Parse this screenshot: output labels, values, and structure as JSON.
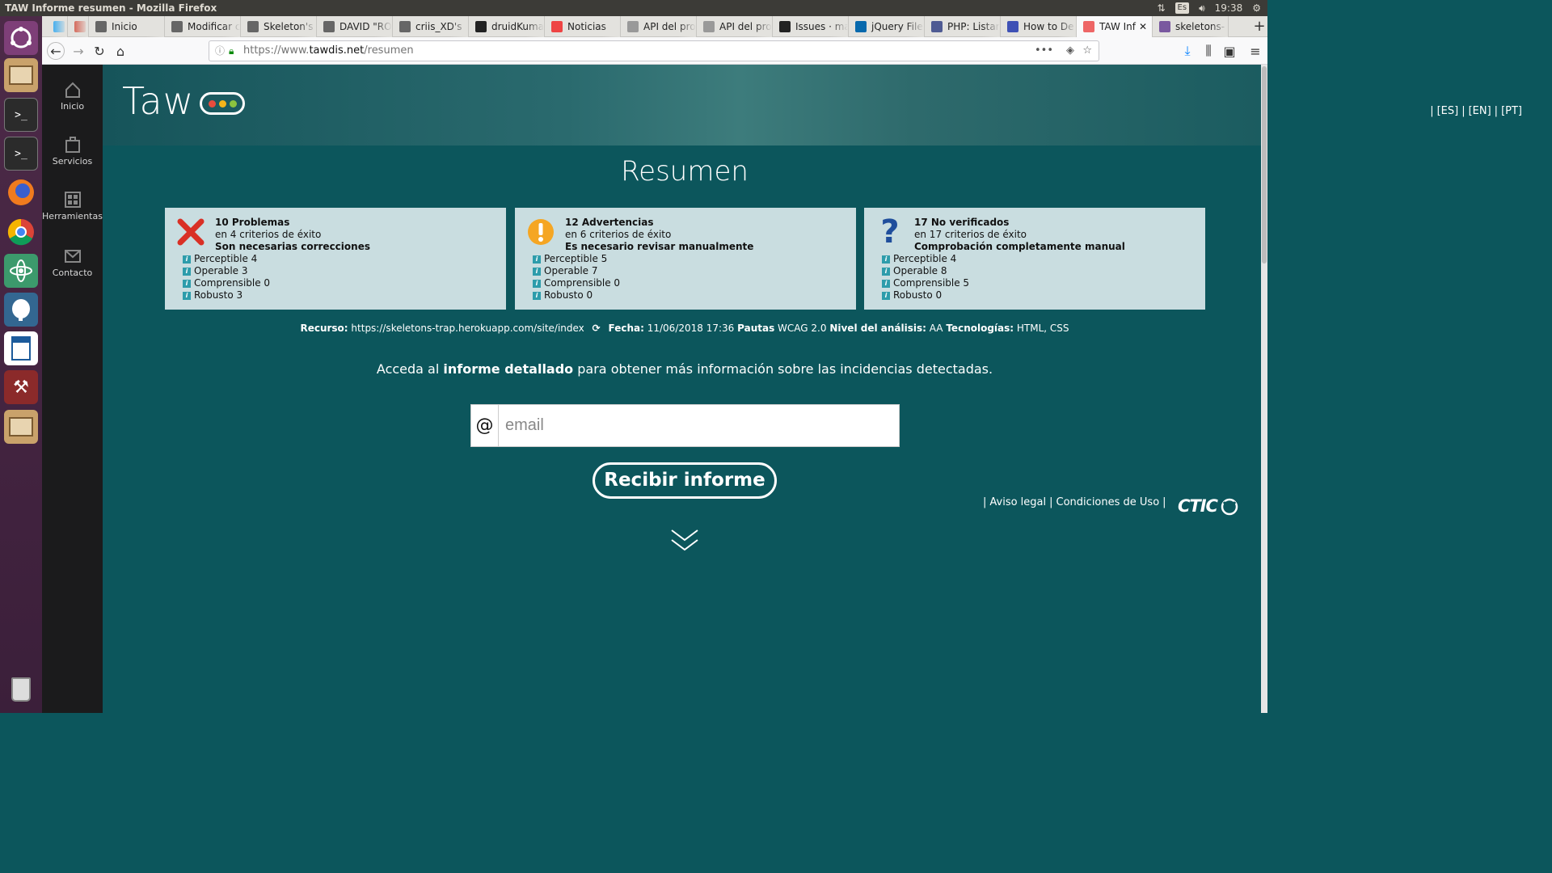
{
  "window": {
    "title": "TAW Informe resumen - Mozilla Firefox",
    "lang_indicator": "Es",
    "clock": "19:38"
  },
  "tabs": [
    {
      "label": "",
      "color": "#1da1f2"
    },
    {
      "label": "",
      "color": "#d14836"
    },
    {
      "label": "Inicio",
      "color": "#666"
    },
    {
      "label": "Modificar c",
      "color": "#666"
    },
    {
      "label": "Skeleton's",
      "color": "#666"
    },
    {
      "label": "DAVID \"RO",
      "color": "#666"
    },
    {
      "label": "criis_XD's",
      "color": "#666"
    },
    {
      "label": "druidKuma",
      "color": "#222"
    },
    {
      "label": "Noticias",
      "color": "#e44"
    },
    {
      "label": "API del proyec",
      "color": "#999"
    },
    {
      "label": "API del proyec",
      "color": "#999"
    },
    {
      "label": "Issues · ma",
      "color": "#222"
    },
    {
      "label": "jQuery File",
      "color": "#0769ad"
    },
    {
      "label": "PHP: Listar",
      "color": "#4f5b93"
    },
    {
      "label": "How to De",
      "color": "#3f51b5"
    },
    {
      "label": "TAW Inf",
      "color": "#e66"
    },
    {
      "label": "skeletons-",
      "color": "#79589f"
    }
  ],
  "url": {
    "prefix": "https://www.",
    "host": "tawdis.net",
    "path": "/resumen"
  },
  "sidebar": [
    {
      "label": "Inicio",
      "icon": "home-icon"
    },
    {
      "label": "Servicios",
      "icon": "briefcase-icon"
    },
    {
      "label": "Herramientas",
      "icon": "grid-icon"
    },
    {
      "label": "Contacto",
      "icon": "mail-icon"
    }
  ],
  "logo": {
    "text": "Taw"
  },
  "languages": [
    "[ES]",
    "[EN]",
    "[PT]"
  ],
  "heading": "Resumen",
  "cards": [
    {
      "icon": "cross-icon",
      "title": "10 Problemas",
      "subtitle": "en 4 criterios de éxito",
      "note": "Son necesarias correcciones",
      "items": [
        "Perceptible 4",
        "Operable 3",
        "Comprensible 0",
        "Robusto 3"
      ]
    },
    {
      "icon": "warning-icon",
      "title": "12 Advertencias",
      "subtitle": "en 6 criterios de éxito",
      "note": "Es necesario revisar manualmente",
      "items": [
        "Perceptible 5",
        "Operable 7",
        "Comprensible 0",
        "Robusto 0"
      ]
    },
    {
      "icon": "question-icon",
      "title": "17 No verificados",
      "subtitle": "en 17 criterios de éxito",
      "note": "Comprobación completamente manual",
      "items": [
        "Perceptible 4",
        "Operable 8",
        "Comprensible 5",
        "Robusto 0"
      ]
    }
  ],
  "meta": {
    "recurso_label": "Recurso:",
    "recurso": "https://skeletons-trap.herokuapp.com/site/index",
    "fecha_label": "Fecha:",
    "fecha": "11/06/2018 17:36",
    "pautas_label": "Pautas",
    "pautas": "WCAG 2.0",
    "nivel_label": "Nivel del análisis:",
    "nivel": "AA",
    "tec_label": "Tecnologías:",
    "tec": "HTML, CSS"
  },
  "access": {
    "pre": "Acceda al ",
    "bold": "informe detallado",
    "post": " para obtener más información sobre las incidencias detectadas."
  },
  "email": {
    "at": "@",
    "placeholder": "email"
  },
  "submit_label": "Recibir informe",
  "footer": {
    "legal": "Aviso legal",
    "terms": "Condiciones de Uso",
    "brand": "CTIC"
  }
}
